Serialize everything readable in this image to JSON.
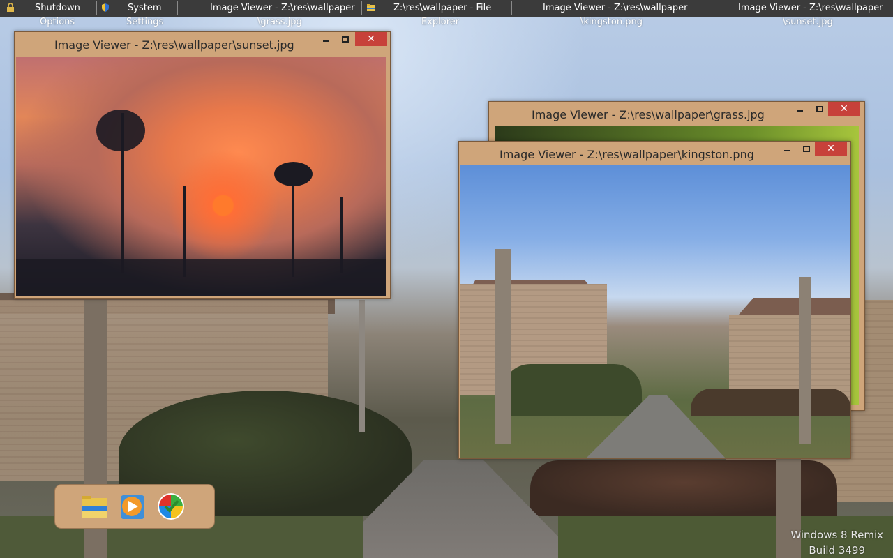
{
  "taskbar": {
    "items": [
      {
        "line1": "Shutdown",
        "line2": "Options"
      },
      {
        "line1": "System",
        "line2": "Settings"
      },
      {
        "line1": "Image Viewer - Z:\\res\\wallpaper",
        "line2": "\\grass.jpg"
      },
      {
        "line1": "Z:\\res\\wallpaper - File",
        "line2": "Explorer"
      },
      {
        "line1": "Image Viewer - Z:\\res\\wallpaper",
        "line2": "\\kingston.png"
      },
      {
        "line1": "Image Viewer - Z:\\res\\wallpaper",
        "line2": "\\sunset.jpg"
      }
    ],
    "icons": [
      "lock-icon",
      "shield-icon",
      "folder-icon"
    ]
  },
  "windows": {
    "sunset": {
      "title": "Image Viewer - Z:\\res\\wallpaper\\sunset.jpg",
      "close_label": "✕"
    },
    "grass": {
      "title": "Image Viewer - Z:\\res\\wallpaper\\grass.jpg",
      "close_label": "✕"
    },
    "kingston": {
      "title": "Image Viewer - Z:\\res\\wallpaper\\kingston.png",
      "close_label": "✕"
    }
  },
  "dock": {
    "icons": [
      "file-explorer-icon",
      "media-player-icon",
      "windows-logo-icon"
    ]
  },
  "watermark": {
    "line1": "Windows 8 Remix",
    "line2": "Build 3499"
  },
  "colors": {
    "window_frame": "#cfa57a",
    "close_button": "#c7413a",
    "taskbar": "#3b3b3b"
  }
}
